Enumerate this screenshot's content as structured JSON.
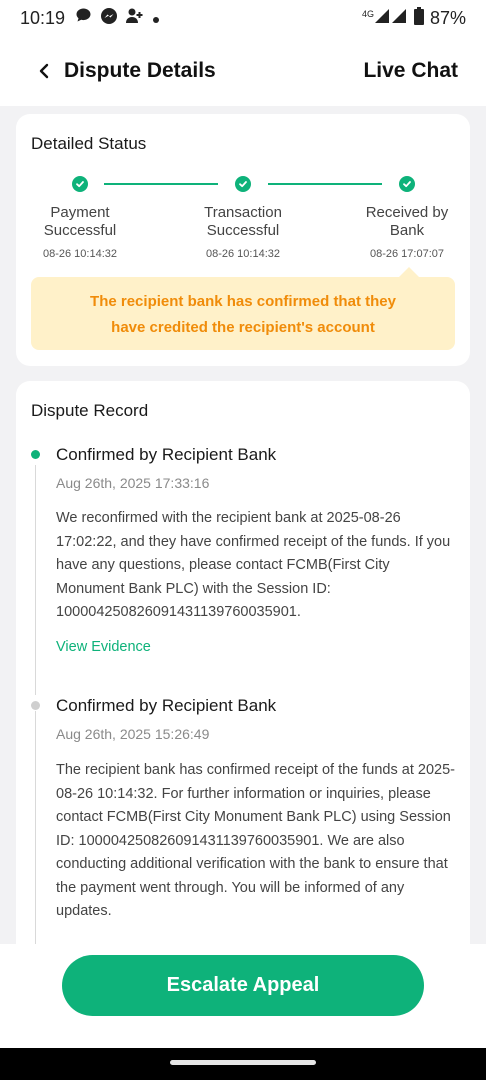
{
  "status_bar": {
    "time": "10:19",
    "network": "4G",
    "battery": "87%",
    "icons": [
      "message-icon",
      "messenger-icon",
      "person-add-icon",
      "dot-icon",
      "signal-icon",
      "battery-icon"
    ]
  },
  "header": {
    "title": "Dispute Details",
    "live_chat": "Live Chat",
    "back_icon": "chevron-left-icon"
  },
  "detailed_status": {
    "title": "Detailed Status",
    "steps": [
      {
        "label": "Payment Successful",
        "time": "08-26 10:14:32"
      },
      {
        "label": "Transaction Successful",
        "time": "08-26 10:14:32"
      },
      {
        "label": "Received by Bank",
        "time": "08-26 17:07:07"
      }
    ],
    "tip": "The recipient bank has confirmed that they have credited the recipient's account"
  },
  "dispute_record": {
    "title": "Dispute Record",
    "records": [
      {
        "title": "Confirmed by Recipient Bank",
        "date": "Aug 26th, 2025 17:33:16",
        "body": "We reconfirmed with the recipient bank at 2025-08-26 17:02:22, and they have confirmed receipt of the funds. If you have any questions, please contact FCMB(First City Monument Bank PLC) with the Session ID: 100004250826091431139760035901.",
        "link": "View Evidence"
      },
      {
        "title": "Confirmed by Recipient Bank",
        "date": "Aug 26th, 2025 15:26:49",
        "body": "The recipient bank has confirmed receipt of the funds at 2025-08-26 10:14:32. For further information or inquiries, please contact FCMB(First City Monument Bank PLC) using Session ID: 100004250826091431139760035901. We are also conducting additional verification with the bank to ensure that the payment went through. You will be informed of any updates."
      }
    ]
  },
  "footer": {
    "button": "Escalate Appeal"
  },
  "colors": {
    "accent": "#0eb27a",
    "tip_bg": "#fff1c9",
    "tip_text": "#f08c0a"
  }
}
